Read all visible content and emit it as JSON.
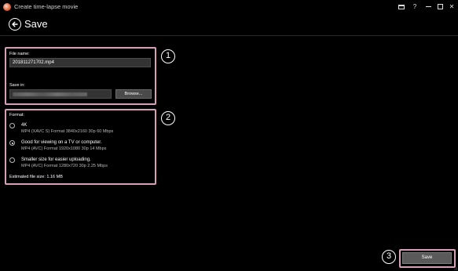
{
  "window": {
    "title": "Create time-lapse movie",
    "controls": {
      "toolbox": "toolbox-icon",
      "help": "?",
      "close": "✕"
    }
  },
  "header": {
    "title": "Save",
    "back_icon": "back-arrow-icon"
  },
  "file_panel": {
    "badge": "1",
    "file_name_label": "File name:",
    "file_name_value": "201811271702.mp4",
    "save_in_label": "Save in:",
    "browse_label": "Browse..."
  },
  "format_panel": {
    "badge": "2",
    "format_label": "Format:",
    "options": [
      {
        "title": "4K",
        "description": "MP4 (XAVC S) Format 3840x2160 30p 60 Mbps",
        "selected": false
      },
      {
        "title": "Good for viewing on a TV or computer.",
        "description": "MP4 (AVC) Format 1920x1080 30p 14 Mbps",
        "selected": true
      },
      {
        "title": "Smaller size for easier uploading.",
        "description": "MP4 (AVC) Format 1280x720 30p 2.25 Mbps",
        "selected": false
      }
    ],
    "estimated_size": "Estimated file size: 1.16 MB"
  },
  "footer": {
    "badge": "3",
    "save_label": "Save"
  },
  "colors": {
    "background": "#000000",
    "highlight_border": "#d8a0b8",
    "input_bg": "#333333",
    "button_bg": "#4a4a4a"
  }
}
